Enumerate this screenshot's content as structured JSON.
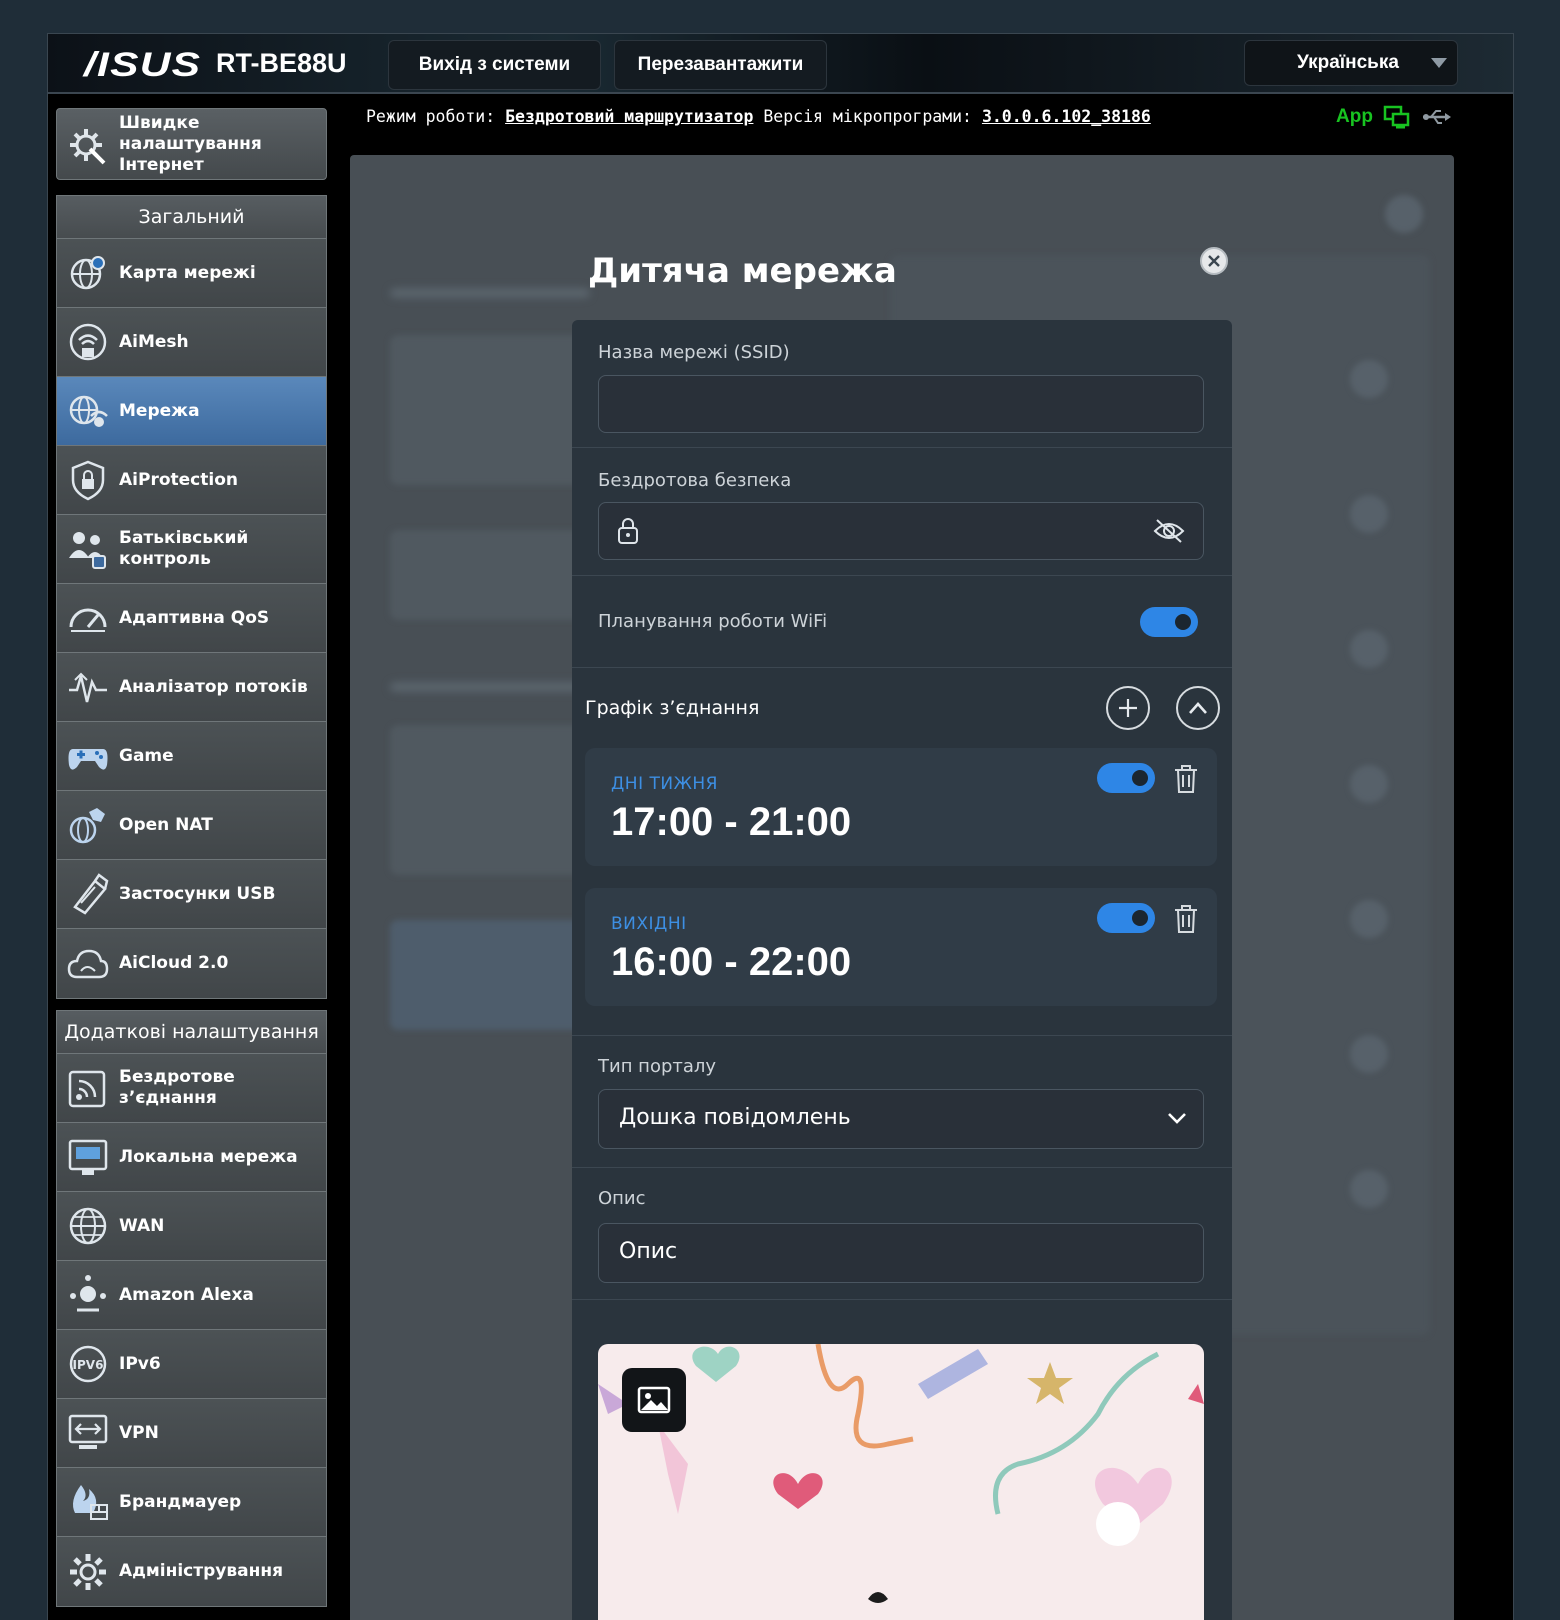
{
  "header": {
    "logo": "/ISUS",
    "model": "RT-BE88U",
    "logout_label": "Вихід з системи",
    "reboot_label": "Перезавантажити",
    "language": "Українська"
  },
  "status": {
    "mode_label": "Режим роботи:",
    "mode_value": "Бездротовий маршрутизатор",
    "fw_label": "Версія мікропрограми:",
    "fw_value": "3.0.0.6.102_38186",
    "app_label": "App"
  },
  "sidebar": {
    "quick_setup": "Швидке налаштування Інтернет",
    "general_header": "Загальний",
    "general_items": [
      {
        "label": "Карта мережі",
        "icon": "network-map-icon"
      },
      {
        "label": "AiMesh",
        "icon": "aimesh-icon"
      },
      {
        "label": "Мережа",
        "icon": "network-icon",
        "active": true
      },
      {
        "label": "AiProtection",
        "icon": "shield-icon"
      },
      {
        "label": "Батьківський контроль",
        "icon": "parental-control-icon"
      },
      {
        "label": "Адаптивна QoS",
        "icon": "qos-gauge-icon"
      },
      {
        "label": "Аналізатор потоків",
        "icon": "traffic-analyzer-icon"
      },
      {
        "label": "Game",
        "icon": "gamepad-icon"
      },
      {
        "label": "Open NAT",
        "icon": "open-nat-icon"
      },
      {
        "label": "Застосунки USB",
        "icon": "usb-icon"
      },
      {
        "label": "AiCloud 2.0",
        "icon": "cloud-icon"
      }
    ],
    "advanced_header": "Додаткові налаштування",
    "advanced_items": [
      {
        "label": "Бездротове з’єднання",
        "icon": "wireless-icon"
      },
      {
        "label": "Локальна мережа",
        "icon": "lan-icon"
      },
      {
        "label": "WAN",
        "icon": "globe-icon"
      },
      {
        "label": "Amazon Alexa",
        "icon": "alexa-icon"
      },
      {
        "label": "IPv6",
        "icon": "ipv6-icon"
      },
      {
        "label": "VPN",
        "icon": "vpn-icon"
      },
      {
        "label": "Брандмауер",
        "icon": "firewall-icon"
      },
      {
        "label": "Адміністрування",
        "icon": "admin-gear-icon"
      }
    ]
  },
  "modal": {
    "title": "Дитяча мережа",
    "ssid_label": "Назва мережі (SSID)",
    "ssid_value": "",
    "security_label": "Бездротова безпека",
    "security_value": "",
    "wifi_schedule_label": "Планування роботи WiFi",
    "wifi_schedule_on": true,
    "connection_schedule_label": "Графік з’єднання",
    "schedules": [
      {
        "days": "ДНІ ТИЖНЯ",
        "time": "17:00 - 21:00",
        "enabled": true
      },
      {
        "days": "ВИХІДНІ",
        "time": "16:00 - 22:00",
        "enabled": true
      }
    ],
    "portal_type_label": "Тип порталу",
    "portal_type_value": "Дошка повідомлень",
    "description_label": "Опис",
    "description_value": "Опис"
  },
  "colors": {
    "accent_blue": "#2e86e6",
    "active_menu": "#4a78ad",
    "app_green": "#18c321",
    "modal_bg": "#2a343d"
  }
}
